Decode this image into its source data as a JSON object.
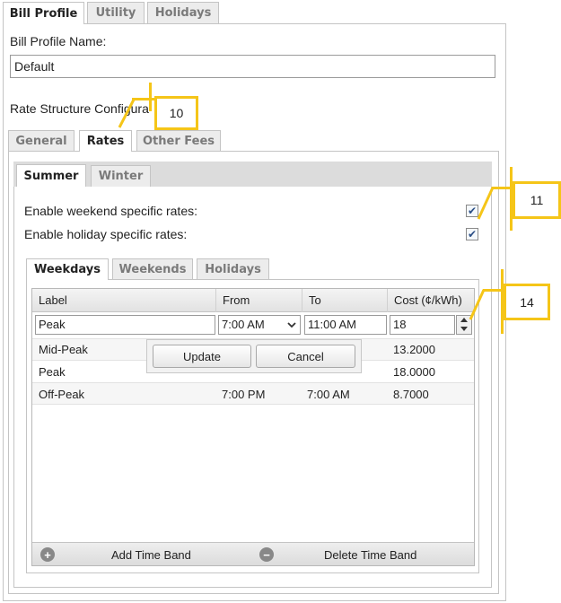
{
  "top_tabs": [
    "Bill Profile",
    "Utility",
    "Holidays"
  ],
  "bill_profile_name": {
    "label": "Bill Profile Name:",
    "value": "Default"
  },
  "rate_structure_label": "Rate Structure Configura",
  "config_tabs": [
    "General",
    "Rates",
    "Other Fees"
  ],
  "season_tabs": [
    "Summer",
    "Winter"
  ],
  "options": {
    "weekend_label": "Enable weekend specific rates:",
    "weekend_checked": true,
    "holiday_label": "Enable holiday specific rates:",
    "holiday_checked": true
  },
  "day_tabs": [
    "Weekdays",
    "Weekends",
    "Holidays"
  ],
  "grid": {
    "columns": [
      "Label",
      "From",
      "To",
      "Cost (¢/kWh)"
    ],
    "editor": {
      "label": "Peak",
      "from": "7:00 AM",
      "to": "11:00 AM",
      "cost": "18"
    },
    "rows": [
      {
        "label": "Mid-Peak",
        "from": "",
        "to": "",
        "cost": "13.2000"
      },
      {
        "label": "Peak",
        "from": "",
        "to": "",
        "cost": "18.0000"
      },
      {
        "label": "Off-Peak",
        "from": "7:00 PM",
        "to": "7:00 AM",
        "cost": "8.7000"
      }
    ],
    "update_label": "Update",
    "cancel_label": "Cancel"
  },
  "footer": {
    "add_label": "Add Time Band",
    "delete_label": "Delete Time Band",
    "add_icon": "+",
    "delete_icon": "−"
  },
  "callouts": [
    "10",
    "11",
    "14"
  ],
  "colors": {
    "callout": "#f5c518",
    "tab_inactive": "#ececec",
    "header_bar": "#dcdcdc"
  }
}
